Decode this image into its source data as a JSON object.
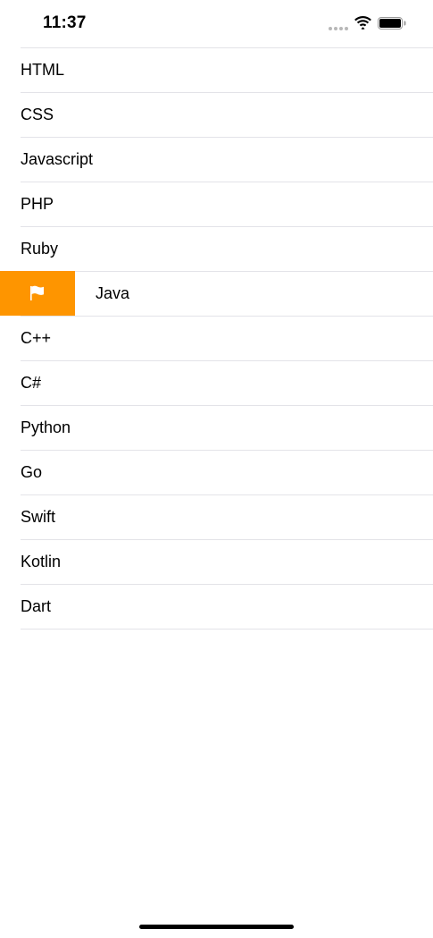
{
  "status_bar": {
    "time": "11:37",
    "icons": [
      "cellular-signal-icon",
      "wifi-icon",
      "battery-icon"
    ]
  },
  "list": {
    "items": [
      {
        "label": "HTML"
      },
      {
        "label": "CSS"
      },
      {
        "label": "Javascript"
      },
      {
        "label": "PHP"
      },
      {
        "label": "Ruby"
      },
      {
        "label": "Java",
        "swiped": true,
        "action": {
          "icon": "flag-icon",
          "color": "#fe9500"
        }
      },
      {
        "label": "C++"
      },
      {
        "label": "C#"
      },
      {
        "label": "Python"
      },
      {
        "label": "Go"
      },
      {
        "label": "Swift"
      },
      {
        "label": "Kotlin"
      },
      {
        "label": "Dart"
      }
    ]
  },
  "colors": {
    "separator": "#e3e3e8",
    "flag_action": "#fe9500",
    "background": "#ffffff"
  }
}
